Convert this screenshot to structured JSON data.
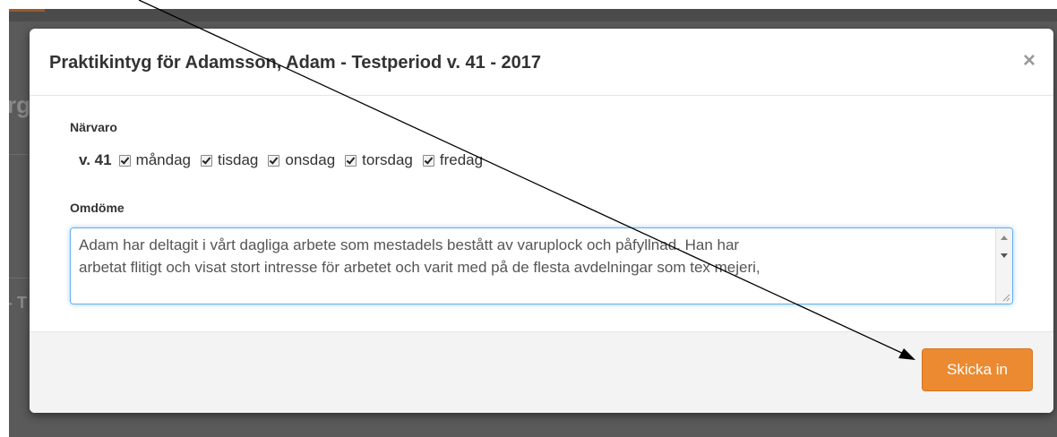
{
  "background": {
    "fragments": [
      "rg",
      "- T"
    ]
  },
  "modal": {
    "title": "Praktikintyg för Adamsson, Adam - Testperiod v. 41 - 2017",
    "close_icon": "close-icon",
    "close_glyph": "×",
    "attendance": {
      "label": "Närvaro",
      "week": "v. 41",
      "days": [
        {
          "label": "måndag",
          "checked": true
        },
        {
          "label": "tisdag",
          "checked": true
        },
        {
          "label": "onsdag",
          "checked": true
        },
        {
          "label": "torsdag",
          "checked": true
        },
        {
          "label": "fredag",
          "checked": true
        }
      ]
    },
    "review": {
      "label": "Omdöme",
      "value": "Adam har deltagit i vårt dagliga arbete som mestadels bestått av varuplock och påfyllnad. Han har\narbetat flitigt och visat stort intresse för arbetet och varit med på de flesta avdelningar som tex mejeri,"
    },
    "submit_label": "Skicka in"
  },
  "colors": {
    "accent": "#ec8a32",
    "focus": "#66afe9",
    "backdrop": "#5a5a5a"
  }
}
